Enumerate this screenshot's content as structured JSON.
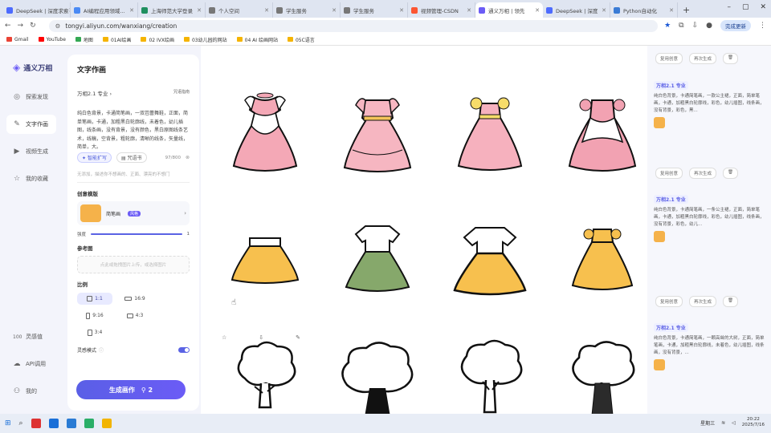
{
  "browser": {
    "tabs": [
      {
        "label": "DeepSeek | 深度求索",
        "color": "#4d6bfe"
      },
      {
        "label": "AI编程应用领域...",
        "color": "#4a8af4"
      },
      {
        "label": "上海师范大学登录",
        "color": "#1f8f5f"
      },
      {
        "label": "个人空间",
        "color": "#777777"
      },
      {
        "label": "学生服务",
        "color": "#777777"
      },
      {
        "label": "学生服务",
        "color": "#777777"
      },
      {
        "label": "视频管理-CSDN",
        "color": "#fc5531"
      },
      {
        "label": "通义万相 | 领先",
        "color": "#6b5cf6",
        "active": true
      },
      {
        "label": "DeepSeek | 深度",
        "color": "#4d6bfe"
      },
      {
        "label": "Python自动化",
        "color": "#3a7bd5"
      }
    ],
    "url": "tongyi.aliyun.com/wanxiang/creation",
    "update_label": "完成更新",
    "bookmarks": [
      "Gmail",
      "YouTube",
      "地图",
      "01AI绘画",
      "02 IVX绘画",
      "03幼儿园的网站",
      "04 AI 绘画网站",
      "05C语言"
    ]
  },
  "sidebar": {
    "brand": "通义万相",
    "items": [
      {
        "label": "探索发现",
        "icon": "compass-icon"
      },
      {
        "label": "文字作画",
        "icon": "brush-icon",
        "active": true
      },
      {
        "label": "视频生成",
        "icon": "video-icon"
      },
      {
        "label": "我的收藏",
        "icon": "star-icon"
      }
    ],
    "bottom": [
      {
        "label": "灵感值",
        "badge": "100"
      },
      {
        "label": "API调用",
        "icon": "cloud-icon"
      },
      {
        "label": "我的",
        "icon": "user-icon"
      }
    ]
  },
  "panel": {
    "title": "文字作画",
    "model": "万相2.1 专业",
    "guide": "咒语指南",
    "prompt": "纯白色背景，卡通简笔画，一双芭蕾舞鞋，正面，简单笔画，卡通，加粗黑白轮廓线，未着色，幼儿插图，线条画，没有背景，没有颜色，黑白原图线条艺术，线稿，空背景，粗轮廓，清晰的线条，矢量线，简单，大。",
    "smart_expand": "智能扩写",
    "inspire": "咒语书",
    "counter": "97/800",
    "negative_placeholder": "无添加，描述你不想画的、正面、漂亮的不想门",
    "creative_template": "创意模版",
    "style_name": "简笔画",
    "style_tag": "风格",
    "strength_label": "强度",
    "strength_value": "1",
    "reference_label": "参考图",
    "reference_placeholder": "点此或拖拽图片上传，或选择图片",
    "ratio_label": "比例",
    "ratios": [
      "1:1",
      "16:9",
      "9:16",
      "4:3",
      "3:4"
    ],
    "inspiration_mode": "灵感模式",
    "generate_label": "生成画作",
    "generate_cost": "2"
  },
  "right": {
    "top_actions": [
      "复用创意",
      "再次生成"
    ],
    "cards": [
      {
        "title": "万相2.1 专业",
        "desc": "纯白色背景，卡通简笔画，一款公主裙，正面，简单笔画，卡通，加粗黑白轮廓线，彩色，幼儿插图，线条画，没有背景，彩色，黑..."
      },
      {
        "title": "万相2.1 专业",
        "desc": "纯白色背景，卡通简笔画，一条公主裙，正面，简单笔画，卡通，加粗黑白轮廓线，彩色，幼儿插图，线条画，没有背景，彩色，幼儿..."
      },
      {
        "title": "万相2.1 专业",
        "desc": "纯白色背景，卡通简笔画，一颗高耸的大树，正面，简单笔画，卡通，加粗黑白轮廓线，未着色，幼儿插图，线条画，没有背景，..."
      }
    ]
  },
  "taskbar": {
    "weekday": "星期三",
    "time": "20:22",
    "date": "2025/7/16"
  }
}
